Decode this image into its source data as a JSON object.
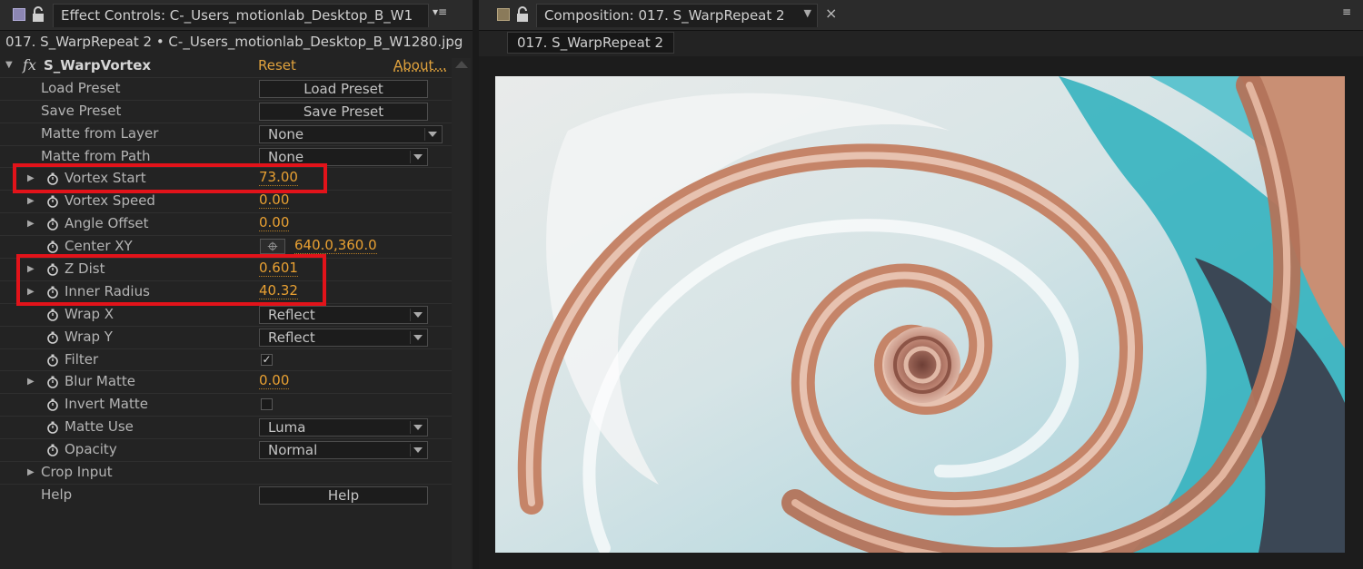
{
  "effect_controls": {
    "tab_title": "Effect Controls: C-_Users_motionlab_Desktop_B_W1",
    "subtitle": "017. S_WarpRepeat 2 • C-_Users_motionlab_Desktop_B_W1280.jpg",
    "effect": {
      "fx_symbol": "fx",
      "name": "S_WarpVortex",
      "reset_label": "Reset",
      "about_label": "About..."
    },
    "properties": [
      {
        "label": "Load Preset",
        "button": "Load Preset"
      },
      {
        "label": "Save Preset",
        "button": "Save Preset"
      },
      {
        "label": "Matte from Layer",
        "dropdown": "None"
      },
      {
        "label": "Matte from Path",
        "dropdown": "None"
      },
      {
        "label": "Vortex Start",
        "value": "73.00"
      },
      {
        "label": "Vortex Speed",
        "value": "0.00"
      },
      {
        "label": "Angle Offset",
        "value": "0.00"
      },
      {
        "label": "Center XY",
        "value": "640.0,360.0"
      },
      {
        "label": "Z Dist",
        "value": "0.601"
      },
      {
        "label": "Inner Radius",
        "value": "40.32"
      },
      {
        "label": "Wrap X",
        "dropdown": "Reflect"
      },
      {
        "label": "Wrap Y",
        "dropdown": "Reflect"
      },
      {
        "label": "Filter",
        "checked": true
      },
      {
        "label": "Blur Matte",
        "value": "0.00"
      },
      {
        "label": "Invert Matte",
        "checked": false
      },
      {
        "label": "Matte Use",
        "dropdown": "Luma"
      },
      {
        "label": "Opacity",
        "dropdown": "Normal"
      },
      {
        "label": "Crop Input"
      },
      {
        "label": "Help",
        "button": "Help"
      }
    ]
  },
  "composition": {
    "tab_title": "Composition: 017. S_WarpRepeat 2",
    "close_symbol": "×",
    "comp_tab": "017. S_WarpRepeat 2"
  },
  "colors": {
    "accent_value": "#e8a032",
    "highlight_box": "#e2131a",
    "panel_bg": "#232323"
  },
  "icons": [
    "panel-swatch-icon",
    "lock-icon",
    "panel-menu-icon",
    "fx-icon",
    "twirl-triangle-icon",
    "stopwatch-icon",
    "crosshair-icon",
    "dropdown-arrow-icon",
    "checkbox-icon",
    "close-icon"
  ]
}
